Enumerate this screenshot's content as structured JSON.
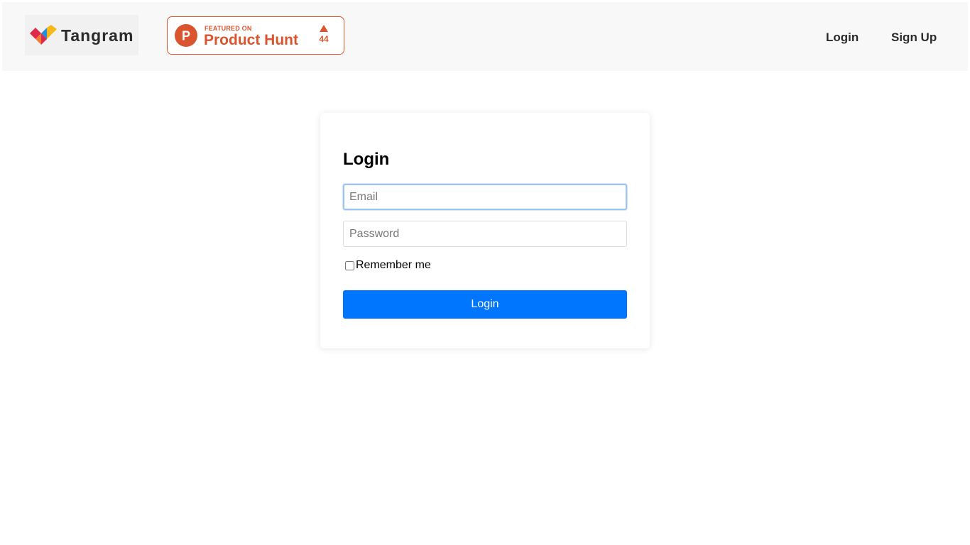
{
  "header": {
    "brand": {
      "name": "Tangram",
      "logo_icon": "tangram-logo-icon"
    },
    "product_hunt_badge": {
      "featured_text": "FEATURED ON",
      "name": "Product Hunt",
      "votes": "44",
      "logo_letter": "P",
      "color": "#da552f"
    },
    "nav": {
      "login_label": "Login",
      "signup_label": "Sign Up"
    }
  },
  "login_form": {
    "title": "Login",
    "email": {
      "placeholder": "Email",
      "value": ""
    },
    "password": {
      "placeholder": "Password",
      "value": ""
    },
    "remember_label": "Remember me",
    "remember_checked": false,
    "submit_label": "Login",
    "accent_color": "#0076fe"
  }
}
